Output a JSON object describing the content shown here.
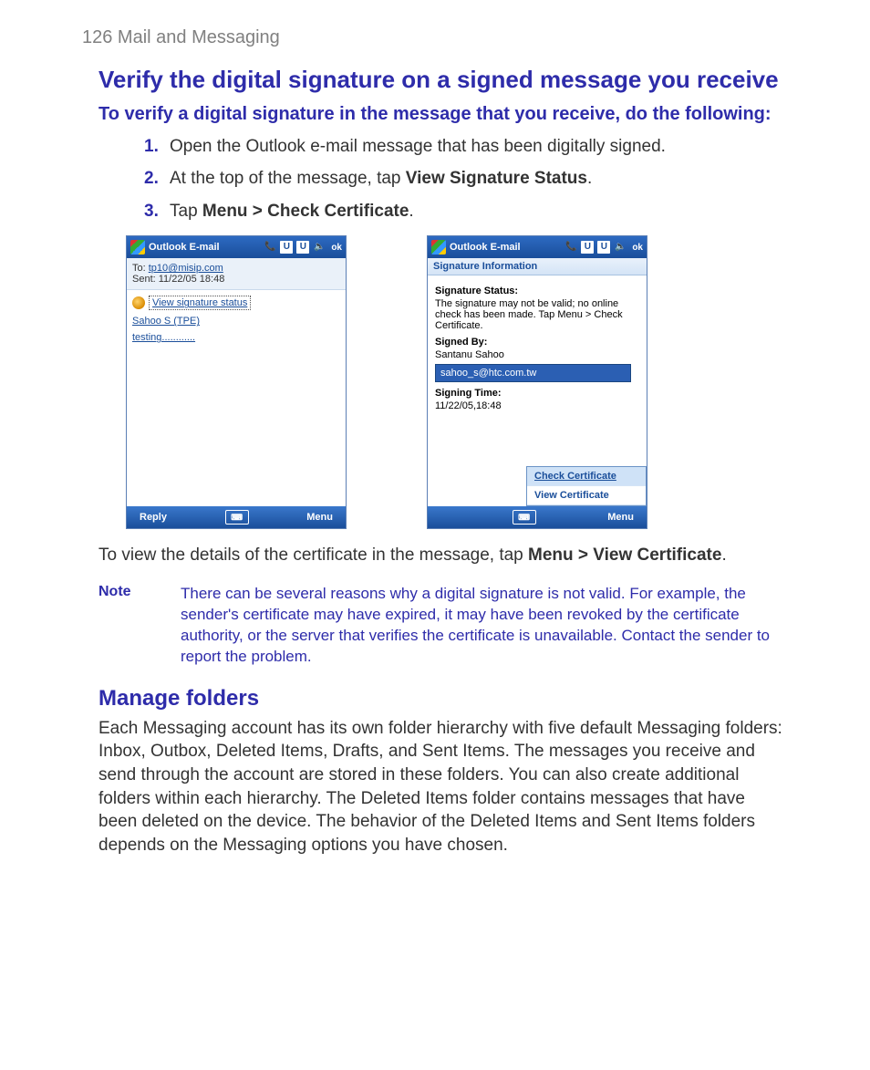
{
  "page_header": "126  Mail and Messaging",
  "h_main": "Verify the digital signature on a signed message you receive",
  "h_sub": "To verify a digital signature in the message that you receive, do the following:",
  "steps": [
    {
      "num": "1.",
      "pre": "Open the Outlook e-mail message that has been digitally signed.",
      "bold": "",
      "post": ""
    },
    {
      "num": "2.",
      "pre": "At the top of the message, tap ",
      "bold": "View Signature Status",
      "post": "."
    },
    {
      "num": "3.",
      "pre": "Tap ",
      "bold": "Menu > Check Certificate",
      "post": "."
    }
  ],
  "shot1": {
    "titlebar_title": "Outlook E-mail",
    "ok": "ok",
    "to_label": "To:",
    "to_value": "tp10@misip.com",
    "sent_label": "Sent:",
    "sent_value": "11/22/05 18:48",
    "view_sig": "View signature status",
    "from": "Sahoo S (TPE)",
    "subject_line": "testing............",
    "soft_left": "Reply",
    "soft_right": "Menu"
  },
  "shot2": {
    "titlebar_title": "Outlook E-mail",
    "ok": "ok",
    "subhead": "Signature Information",
    "status_lbl": "Signature Status:",
    "status_val": "The signature may not be valid; no online check has been made. Tap Menu > Check Certificate.",
    "signedby_lbl": "Signed By:",
    "signedby_val": "Santanu Sahoo",
    "email": "sahoo_s@htc.com.tw",
    "time_lbl": "Signing Time:",
    "time_val": "11/22/05,18:48",
    "menu_check": "Check Certificate",
    "menu_view": "View Certificate",
    "soft_right": "Menu"
  },
  "body_after": {
    "pre": "To view the details of the certificate in the message, tap ",
    "bold": "Menu > View Certificate",
    "post": "."
  },
  "note_label": "Note",
  "note_text": "There can be several reasons why a digital signature is not valid. For example, the sender's certificate may have expired, it may have been revoked by the certificate authority, or the server that verifies the certificate is unavailable. Contact the sender to report the problem.",
  "h_section": "Manage folders",
  "section_body": "Each Messaging account has its own folder hierarchy with five default Messaging folders: Inbox, Outbox, Deleted Items, Drafts, and Sent Items. The messages you receive and send through the account are stored in these folders. You can also create additional folders within each hierarchy. The Deleted Items folder contains messages that have been deleted on the device. The behavior of the Deleted Items and Sent Items folders depends on the Messaging options you have chosen."
}
